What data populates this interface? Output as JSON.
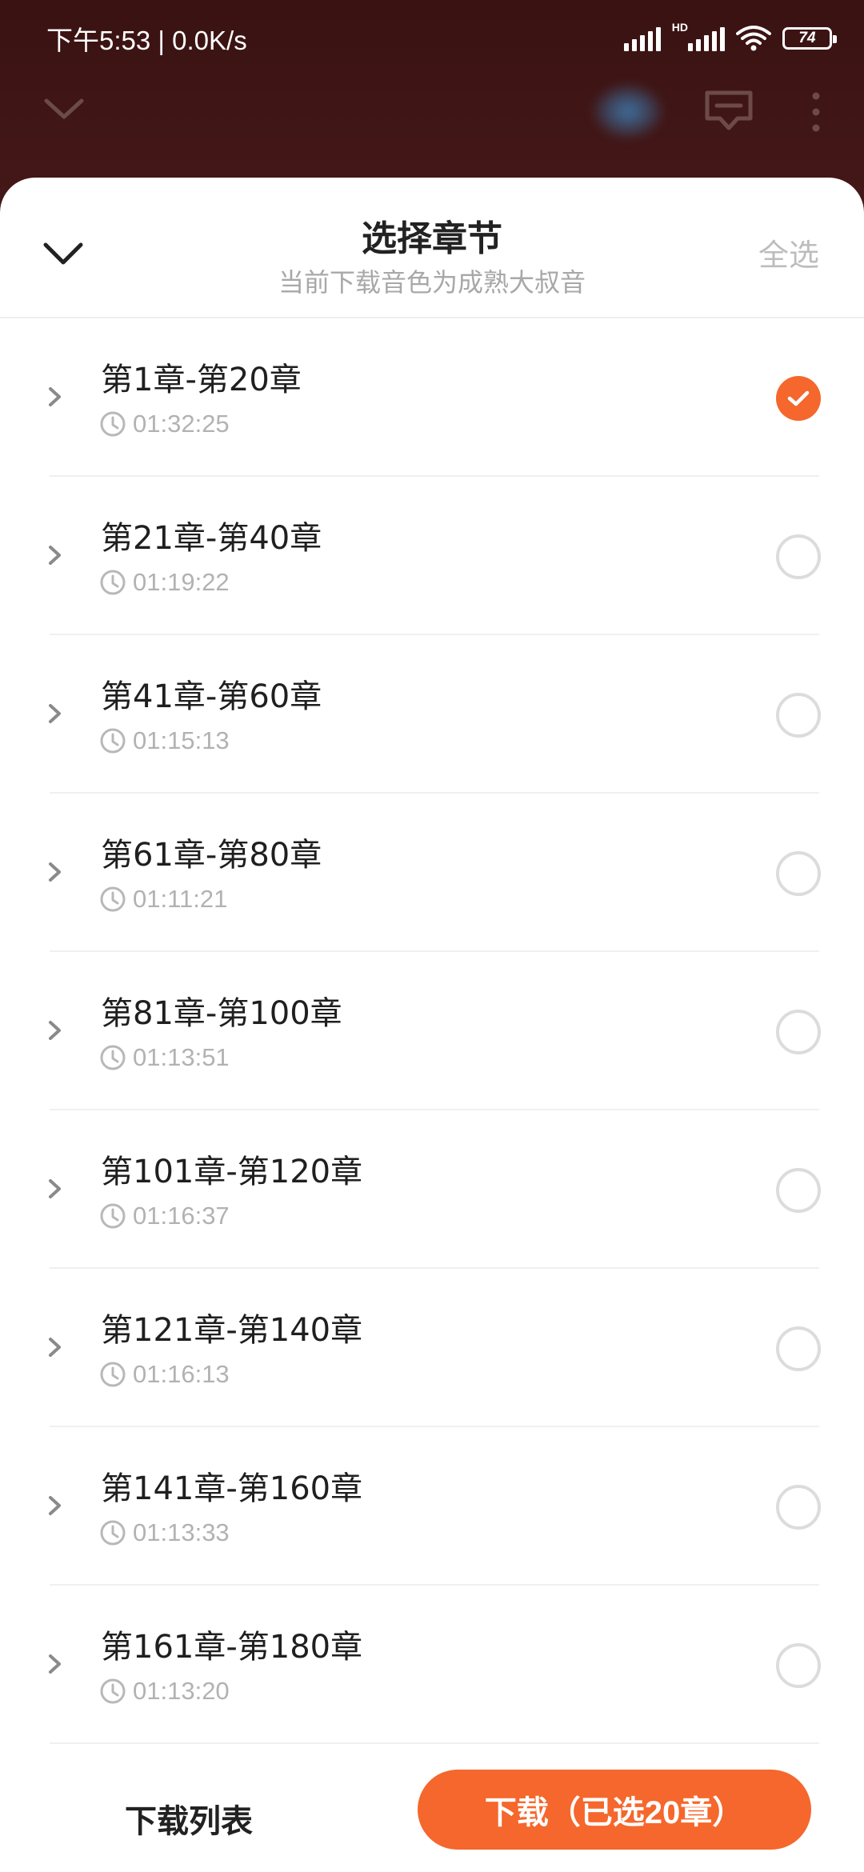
{
  "status_bar": {
    "time_speed": "下午5:53 | 0.0K/s",
    "hd_tag": "HD",
    "battery": "74"
  },
  "header": {
    "title": "选择章节",
    "subtitle": "当前下载音色为成熟大叔音",
    "select_all": "全选"
  },
  "chapters": [
    {
      "title": "第1章-第20章",
      "duration": "01:32:25",
      "checked": true
    },
    {
      "title": "第21章-第40章",
      "duration": "01:19:22",
      "checked": false
    },
    {
      "title": "第41章-第60章",
      "duration": "01:15:13",
      "checked": false
    },
    {
      "title": "第61章-第80章",
      "duration": "01:11:21",
      "checked": false
    },
    {
      "title": "第81章-第100章",
      "duration": "01:13:51",
      "checked": false
    },
    {
      "title": "第101章-第120章",
      "duration": "01:16:37",
      "checked": false
    },
    {
      "title": "第121章-第140章",
      "duration": "01:16:13",
      "checked": false
    },
    {
      "title": "第141章-第160章",
      "duration": "01:13:33",
      "checked": false
    },
    {
      "title": "第161章-第180章",
      "duration": "01:13:20",
      "checked": false
    }
  ],
  "footer": {
    "download_list": "下载列表",
    "download_button": "下载（已选20章）"
  },
  "colors": {
    "accent": "#f5672c",
    "background_dark": "#3b1414",
    "muted_text": "#b2b2b2"
  },
  "icons": {
    "collapse": "chevron-down-icon",
    "cast": "cast-icon",
    "more": "more-vertical-icon",
    "row_expand": "chevron-right-icon",
    "duration": "clock-icon",
    "selected": "check-icon"
  }
}
